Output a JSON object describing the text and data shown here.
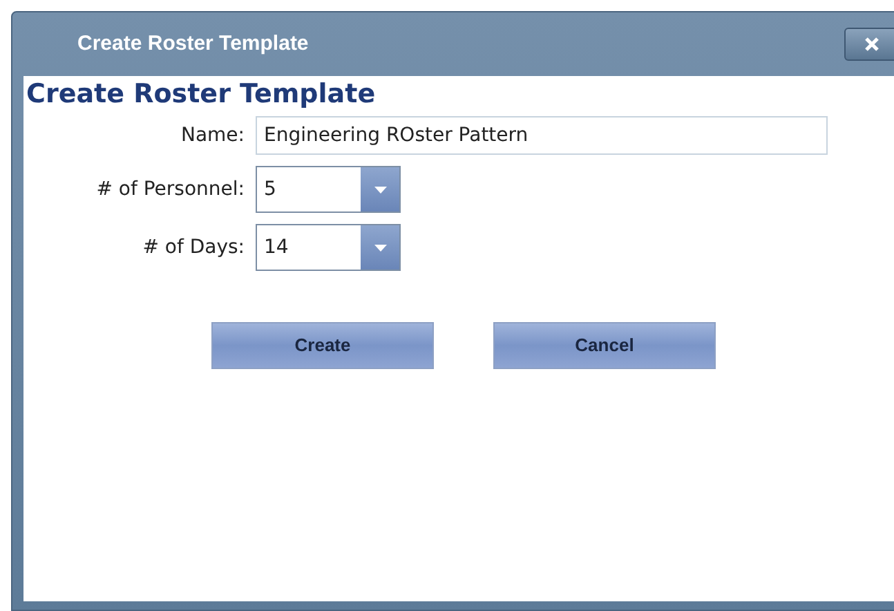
{
  "window": {
    "title": "Create Roster Template"
  },
  "heading": "Create Roster Template",
  "fields": [
    {
      "kind": "text",
      "label": "Name:",
      "value": "Engineering ROster Pattern"
    },
    {
      "kind": "select",
      "label": "# of Personnel:",
      "value": "5"
    },
    {
      "kind": "select",
      "label": "# of Days:",
      "value": "14"
    }
  ],
  "buttons": [
    "Create",
    "Cancel"
  ]
}
